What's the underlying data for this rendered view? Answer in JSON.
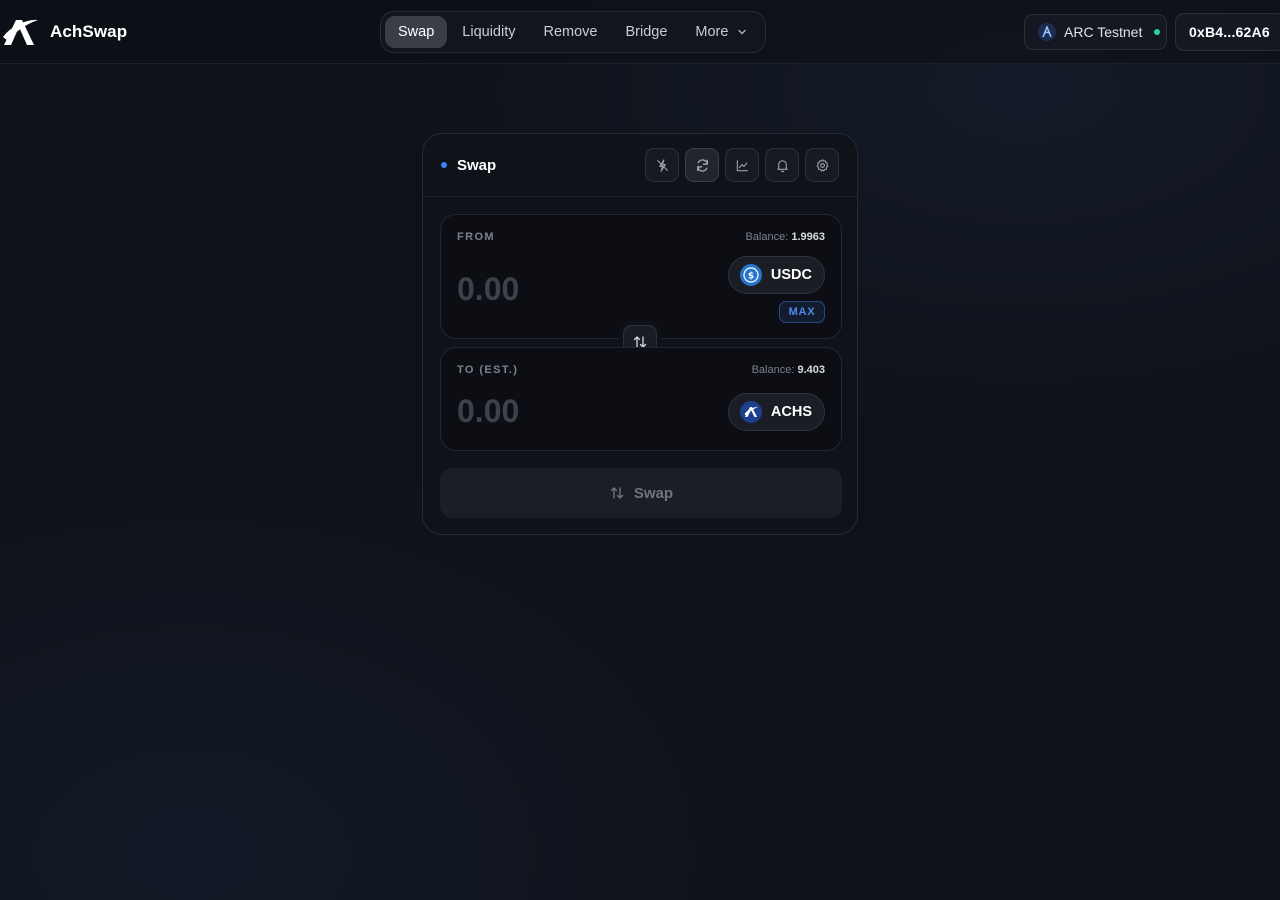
{
  "brand": {
    "name": "AchSwap"
  },
  "nav": {
    "items": [
      {
        "label": "Swap",
        "active": true
      },
      {
        "label": "Liquidity"
      },
      {
        "label": "Remove"
      },
      {
        "label": "Bridge"
      },
      {
        "label": "More"
      }
    ]
  },
  "network": {
    "label": "ARC Testnet",
    "status_color": "#28d4a0"
  },
  "wallet": {
    "address": "0xB4...62A6"
  },
  "card": {
    "title": "Swap",
    "accent_color": "#3b82f6",
    "tools": [
      "no-tools-icon",
      "refresh-icon",
      "chart-icon",
      "bell-icon",
      "gear-icon"
    ]
  },
  "from": {
    "label": "FROM",
    "balance_label": "Balance:",
    "balance_value": "1.9963",
    "amount_placeholder": "0.00",
    "token": "USDC",
    "max_label": "MAX"
  },
  "to": {
    "label": "TO (EST.)",
    "balance_label": "Balance:",
    "balance_value": "9.403",
    "amount_placeholder": "0.00",
    "token": "ACHS"
  },
  "action": {
    "label": "Swap"
  }
}
